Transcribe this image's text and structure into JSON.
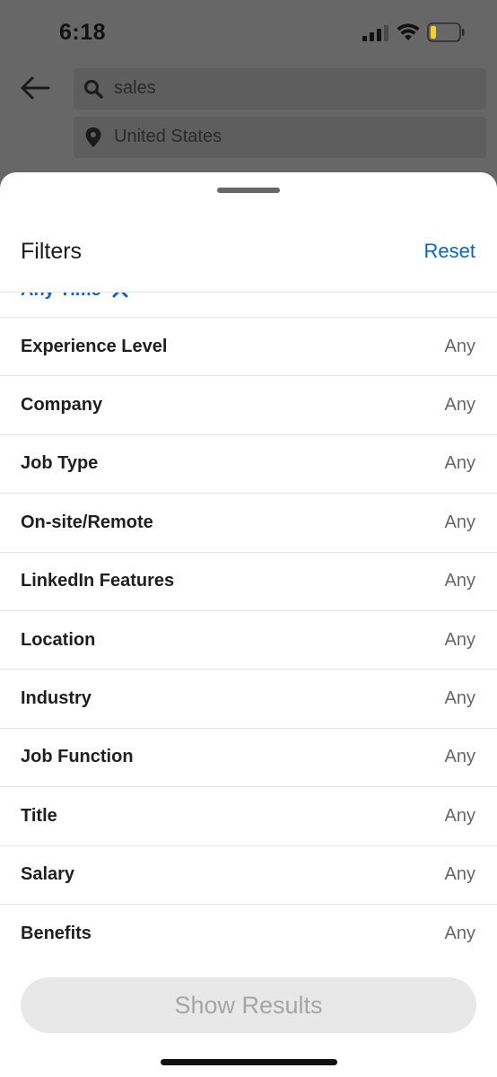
{
  "status": {
    "time": "6:18"
  },
  "background": {
    "search_text": "sales",
    "location_text": "United States"
  },
  "sheet": {
    "title": "Filters",
    "reset_label": "Reset",
    "active_chip": "Any Time",
    "filters": [
      {
        "label": "Experience Level",
        "value": "Any"
      },
      {
        "label": "Company",
        "value": "Any"
      },
      {
        "label": "Job Type",
        "value": "Any"
      },
      {
        "label": "On-site/Remote",
        "value": "Any"
      },
      {
        "label": "LinkedIn Features",
        "value": "Any"
      },
      {
        "label": "Location",
        "value": "Any"
      },
      {
        "label": "Industry",
        "value": "Any"
      },
      {
        "label": "Job Function",
        "value": "Any"
      },
      {
        "label": "Title",
        "value": "Any"
      },
      {
        "label": "Salary",
        "value": "Any"
      },
      {
        "label": "Benefits",
        "value": "Any"
      }
    ],
    "show_results_label": "Show Results"
  },
  "colors": {
    "accent": "#0a66c2",
    "overlay": "#676767",
    "disabled_button": "#e8e8e8"
  },
  "battery_level": 0.2
}
